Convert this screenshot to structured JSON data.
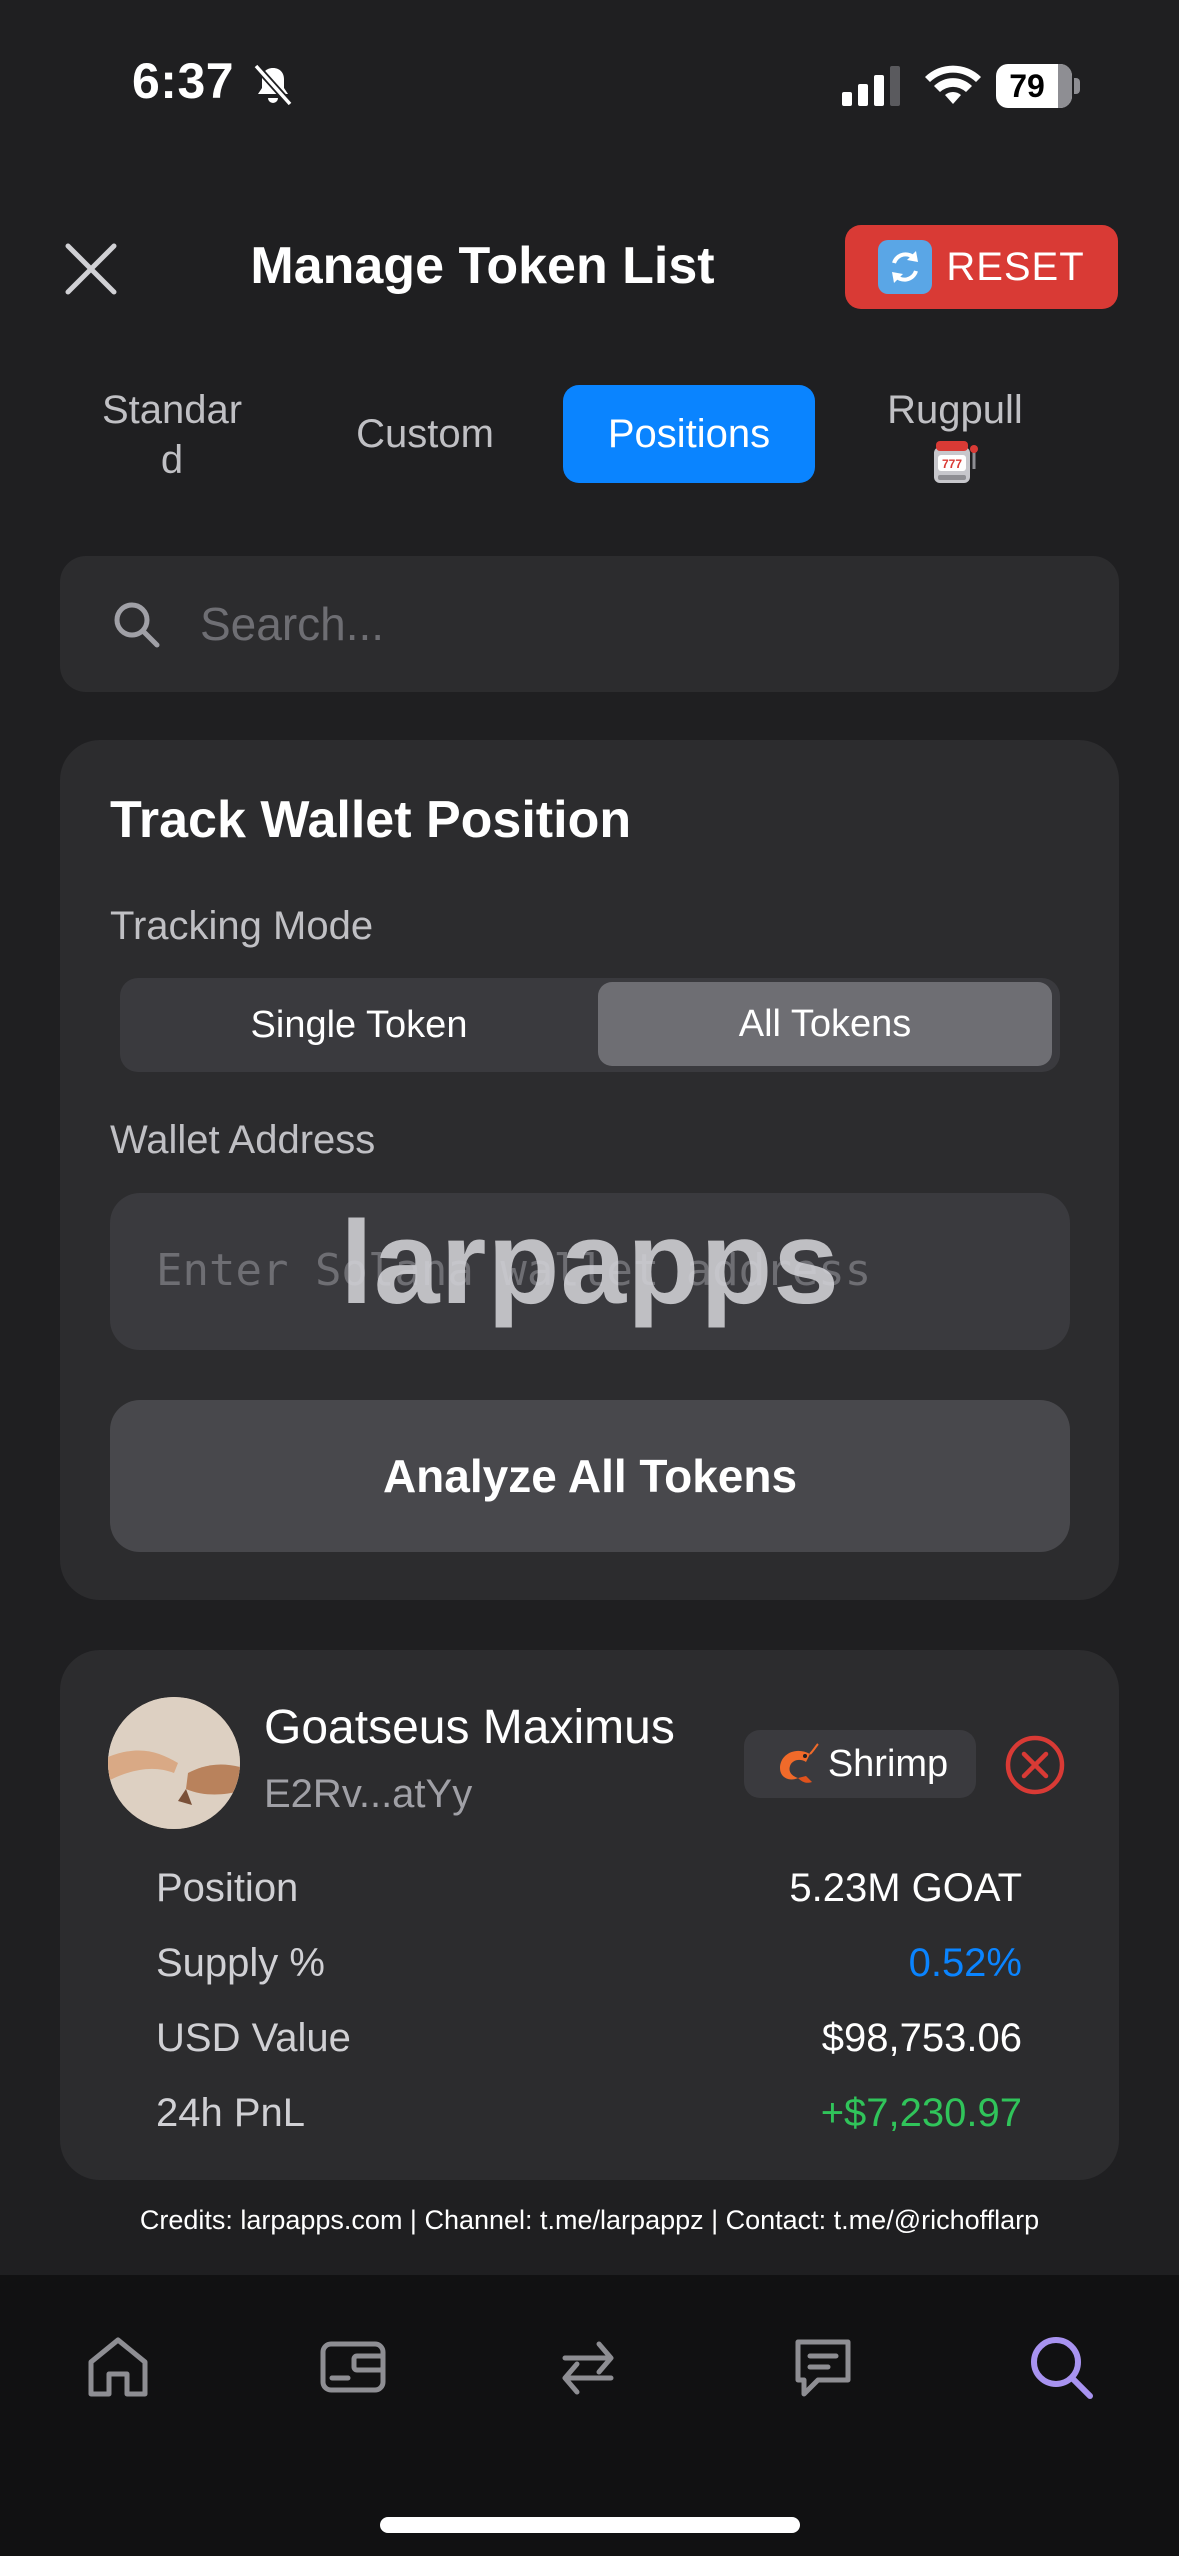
{
  "status_bar": {
    "time": "6:37",
    "battery": "79"
  },
  "header": {
    "title": "Manage Token List",
    "reset_label": "RESET"
  },
  "tabs": {
    "standard": "Standar\nd",
    "custom": "Custom",
    "positions": "Positions",
    "rugpull": "Rugpull"
  },
  "search": {
    "placeholder": "Search..."
  },
  "track": {
    "title": "Track Wallet Position",
    "mode_label": "Tracking Mode",
    "mode_single": "Single Token",
    "mode_all": "All Tokens",
    "mode_selected": "All Tokens",
    "wallet_label": "Wallet Address",
    "wallet_placeholder": "Enter Solana wallet address",
    "watermark": "larpapps",
    "analyze_label": "Analyze All Tokens"
  },
  "position": {
    "name": "Goatseus Maximus",
    "address": "E2Rv...atYy",
    "badge": "Shrimp",
    "rows": [
      {
        "label": "Position",
        "value": "5.23M GOAT"
      },
      {
        "label": "Supply %",
        "value": "0.52%"
      },
      {
        "label": "USD Value",
        "value": "$98,753.06"
      },
      {
        "label": "24h PnL",
        "value": "+$7,230.97"
      }
    ]
  },
  "credits": "Credits: larpapps.com | Channel: t.me/larpappz | Contact: t.me/@richofflarp",
  "colors": {
    "accent": "#0a84ff",
    "reset": "#d93a35",
    "positive": "#30c45a",
    "active_nav": "#a893f0"
  }
}
